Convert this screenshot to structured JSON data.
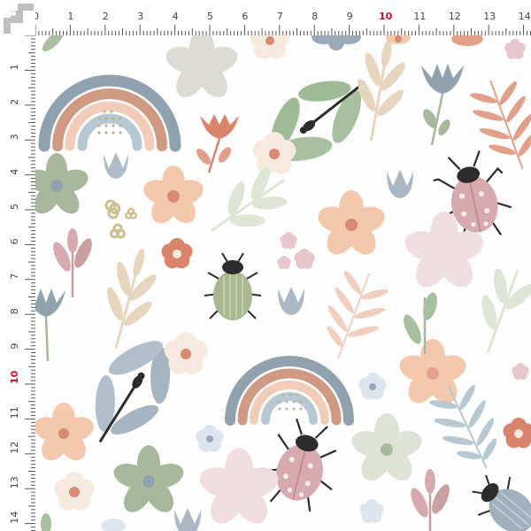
{
  "ruler": {
    "unit_labels": [
      "0",
      "1",
      "2",
      "3",
      "4",
      "5",
      "6",
      "7",
      "8",
      "9",
      "10",
      "11",
      "12",
      "13",
      "14"
    ],
    "highlight": "10",
    "colors": {
      "tick": "#555555",
      "label": "#444444",
      "highlight": "#c8102e",
      "bg": "#ffffff"
    }
  },
  "pattern": {
    "motifs": [
      "rainbow",
      "dragonfly",
      "beetle",
      "ladybug",
      "flower",
      "tulip",
      "leaf-sprig",
      "fern",
      "blossom"
    ],
    "palette": {
      "rainbow_blue": "#8fa2ae",
      "rainbow_terracotta": "#d09a82",
      "rainbow_peach": "#f1cdb9",
      "rainbow_light_blue": "#b6c8d1",
      "sage": "#a7b89c",
      "peach": "#f3c8ad",
      "blush": "#f0dfe1",
      "terracotta": "#d9846b",
      "cream": "#f6eade",
      "dusty_blue": "#9aa9b7",
      "beige": "#e6d6c0",
      "dark": "#2c2c2c"
    }
  }
}
